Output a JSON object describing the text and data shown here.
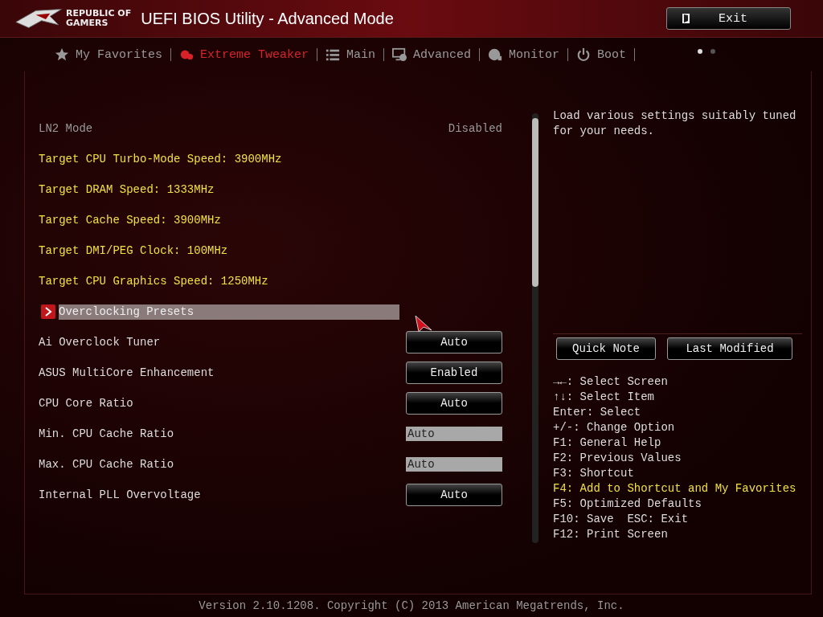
{
  "header": {
    "logo_line_1": "REPUBLIC OF",
    "logo_line_2": "GAMERS",
    "title": "UEFI BIOS Utility - Advanced Mode",
    "exit_button": "Exit"
  },
  "tabs": [
    {
      "label": "My Favorites",
      "kind": "star",
      "selected": false
    },
    {
      "label": "Extreme Tweaker",
      "kind": "tweaker",
      "selected": true
    },
    {
      "label": "Main",
      "kind": "list",
      "selected": false
    },
    {
      "label": "Advanced",
      "kind": "monitor",
      "selected": false
    },
    {
      "label": "Monitor",
      "kind": "gauge",
      "selected": false
    },
    {
      "label": "Boot",
      "kind": "power",
      "selected": false
    }
  ],
  "pages": [
    {
      "selected": true
    },
    {
      "selected": false
    }
  ],
  "settings": [
    {
      "kind": "info",
      "label": "LN2 Mode",
      "value": "Disabled"
    },
    {
      "kind": "target",
      "label": "Target CPU Turbo-Mode Speed: 3900MHz"
    },
    {
      "kind": "target",
      "label": "Target DRAM Speed: 1333MHz"
    },
    {
      "kind": "target",
      "label": "Target Cache Speed: 3900MHz"
    },
    {
      "kind": "target",
      "label": "Target DMI/PEG Clock: 100MHz"
    },
    {
      "kind": "target",
      "label": "Target CPU Graphics Speed: 1250MHz"
    },
    {
      "kind": "submenu",
      "label": "Overclocking Presets",
      "selected": true
    },
    {
      "kind": "button",
      "label": "Ai Overclock Tuner",
      "value": "Auto"
    },
    {
      "kind": "button",
      "label": "ASUS MultiCore Enhancement",
      "value": "Enabled"
    },
    {
      "kind": "button",
      "label": "CPU Core Ratio",
      "value": "Auto"
    },
    {
      "kind": "field",
      "label": "Min. CPU Cache Ratio",
      "value": "Auto"
    },
    {
      "kind": "field",
      "label": "Max. CPU Cache Ratio",
      "value": "Auto"
    },
    {
      "kind": "button",
      "label": "Internal PLL Overvoltage",
      "value": "Auto"
    }
  ],
  "help_text": "Load various settings suitably tuned for your needs.",
  "buttons": [
    "Quick Note",
    "Last Modified"
  ],
  "keys": [
    {
      "text": "→←: Select Screen",
      "highlighted": false
    },
    {
      "text": "↑↓: Select Item",
      "highlighted": false
    },
    {
      "text": "Enter: Select",
      "highlighted": false
    },
    {
      "text": "+/-: Change Option",
      "highlighted": false
    },
    {
      "text": "F1: General Help",
      "highlighted": false
    },
    {
      "text": "F2: Previous Values",
      "highlighted": false
    },
    {
      "text": "F3: Shortcut",
      "highlighted": false
    },
    {
      "text": "F4: Add to Shortcut and My Favorites",
      "highlighted": true
    },
    {
      "text": "F5: Optimized Defaults",
      "highlighted": false
    },
    {
      "text": "F10: Save  ESC: Exit",
      "highlighted": false
    },
    {
      "text": "F12: Print Screen",
      "highlighted": false
    }
  ],
  "footer": "Version 2.10.1208. Copyright (C) 2013 American Megatrends, Inc."
}
